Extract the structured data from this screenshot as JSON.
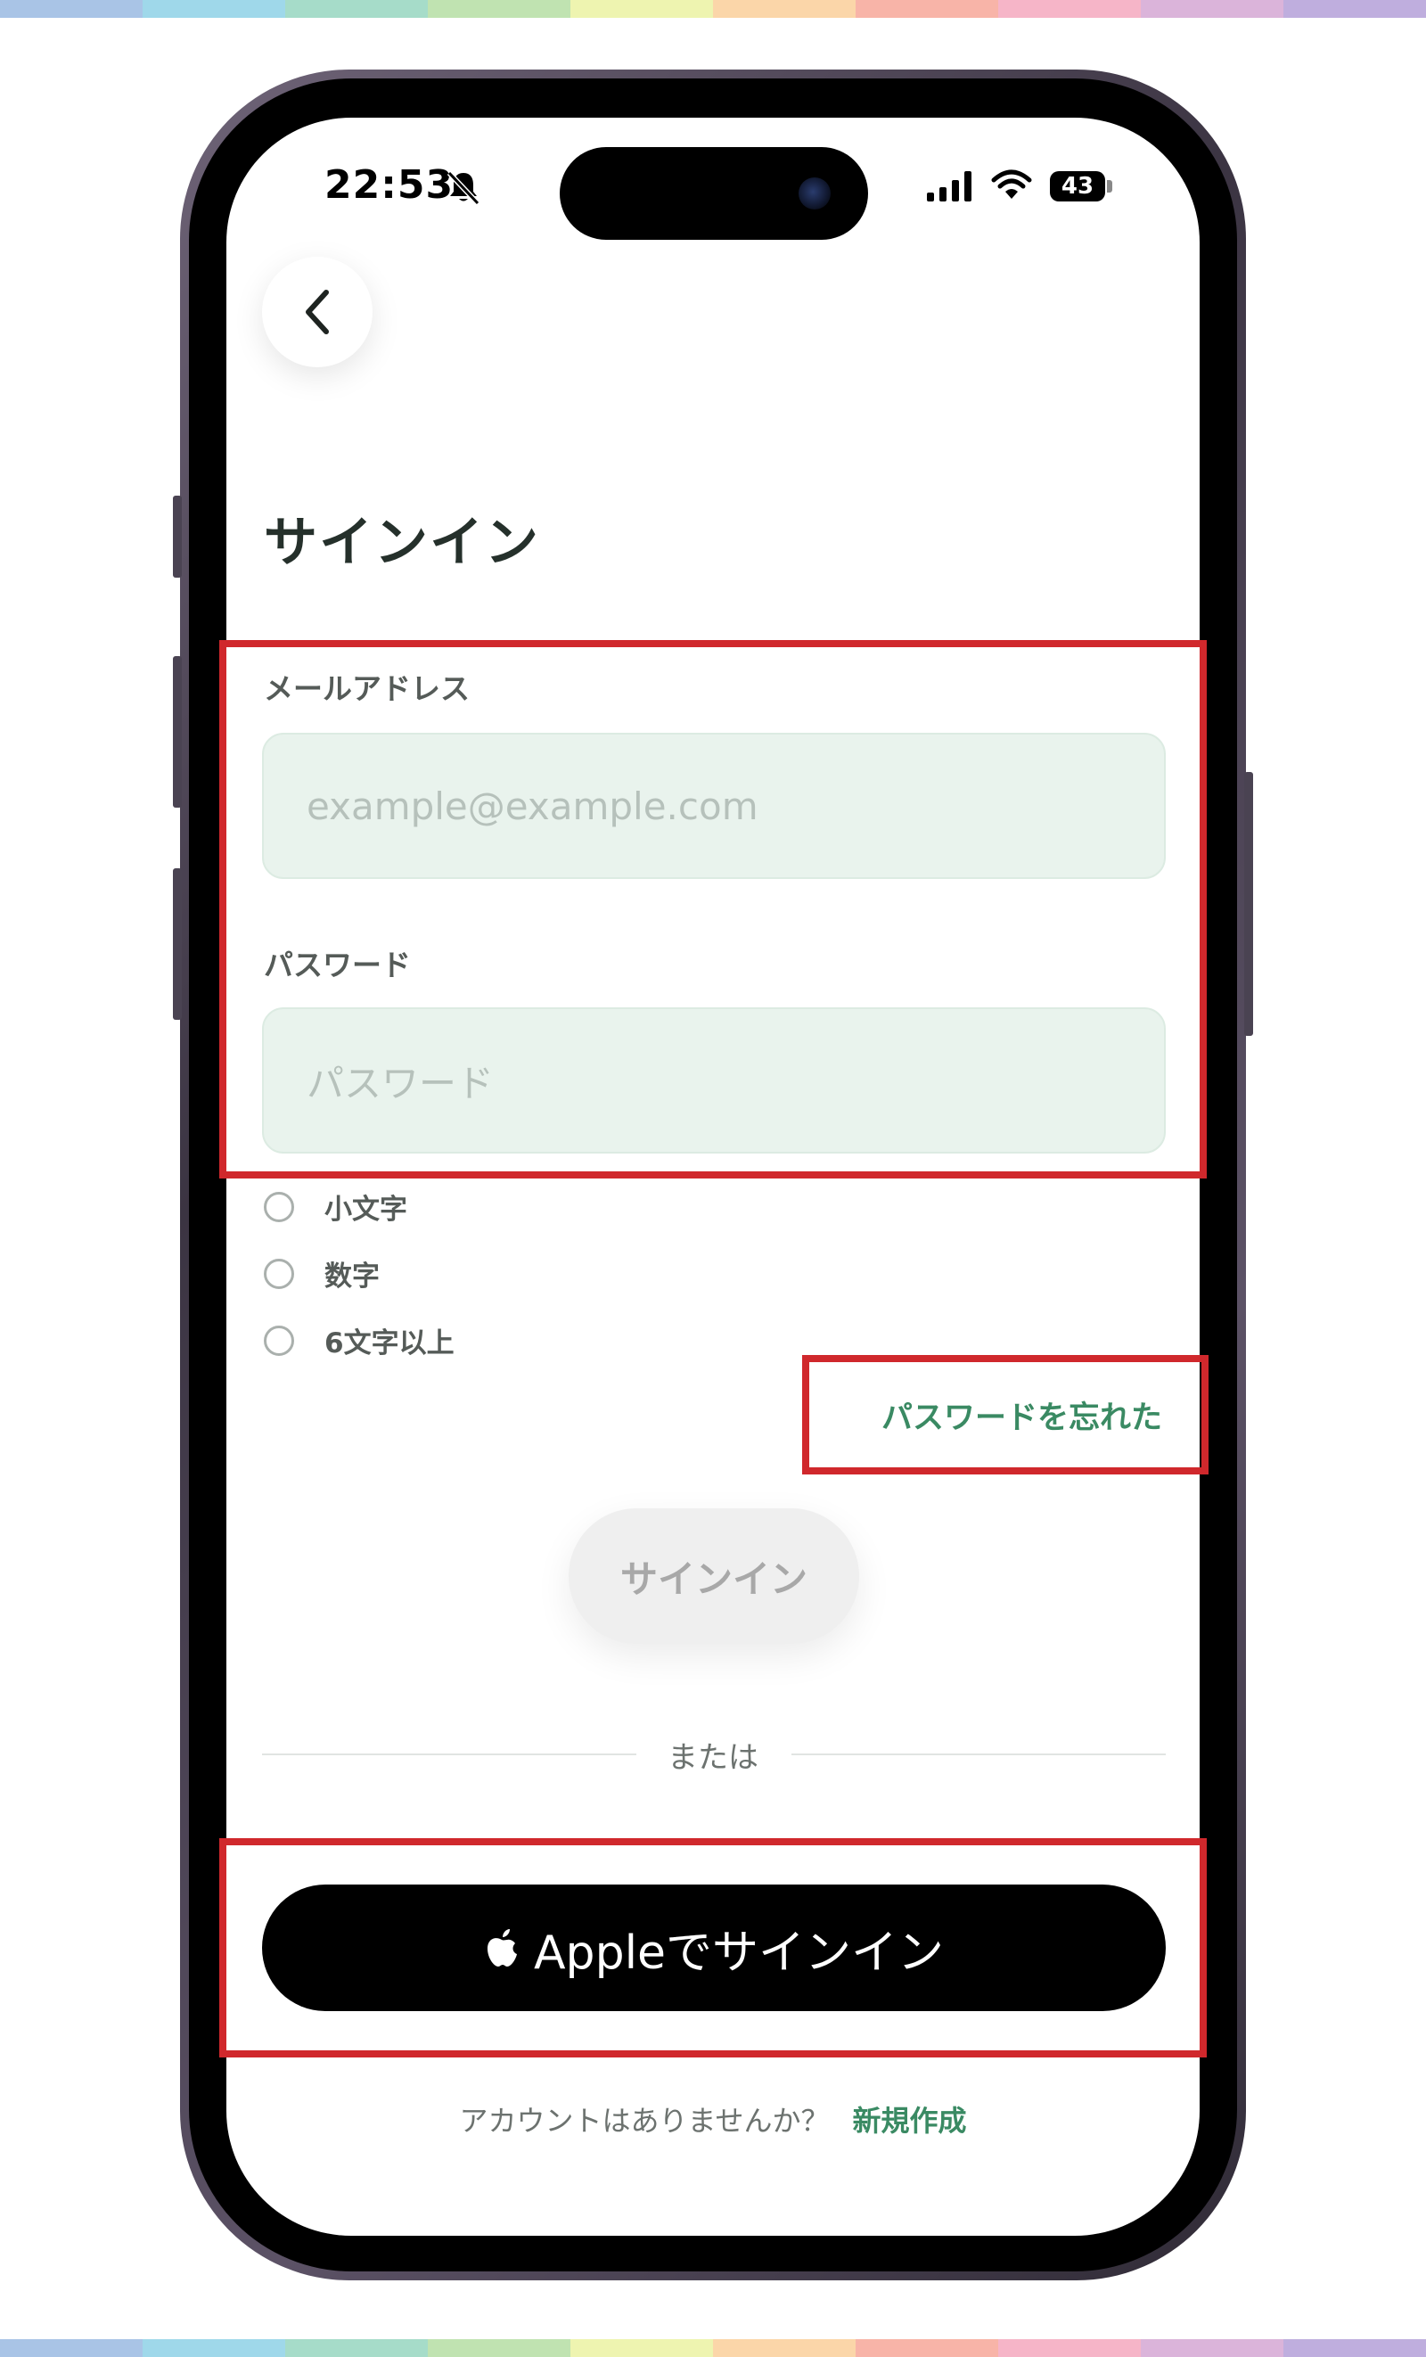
{
  "stripe_colors": [
    "#a9c4e6",
    "#9fd8ea",
    "#a6dcc9",
    "#c0e3b1",
    "#eef4b0",
    "#fbd6a9",
    "#f8b4a8",
    "#f6b5c8",
    "#dbb4da",
    "#bfaede"
  ],
  "status_bar": {
    "time": "22:53",
    "battery": "43",
    "icons": [
      "bell-slash-icon",
      "signal-icon",
      "wifi-icon",
      "battery-icon"
    ]
  },
  "back_icon": "chevron-left-icon",
  "title": "サインイン",
  "email": {
    "label": "メールアドレス",
    "placeholder": "example@example.com",
    "value": ""
  },
  "password": {
    "label": "パスワード",
    "placeholder": "パスワード",
    "value": ""
  },
  "requirements": [
    {
      "label": "小文字",
      "met": false
    },
    {
      "label": "数字",
      "met": false
    },
    {
      "label": "6文字以上",
      "met": false
    }
  ],
  "forgot_password": "パスワードを忘れた",
  "signin_button": "サインイン",
  "divider": "または",
  "apple_signin": {
    "label": "Appleでサインイン",
    "icon": "apple-logo-icon"
  },
  "footer": {
    "question": "アカウントはありませんか？",
    "link": "新規作成"
  },
  "colors": {
    "accent_green": "#3a8a63",
    "input_bg": "#e9f3ed",
    "highlight_red": "#d0282c",
    "title_text": "#25302b"
  }
}
